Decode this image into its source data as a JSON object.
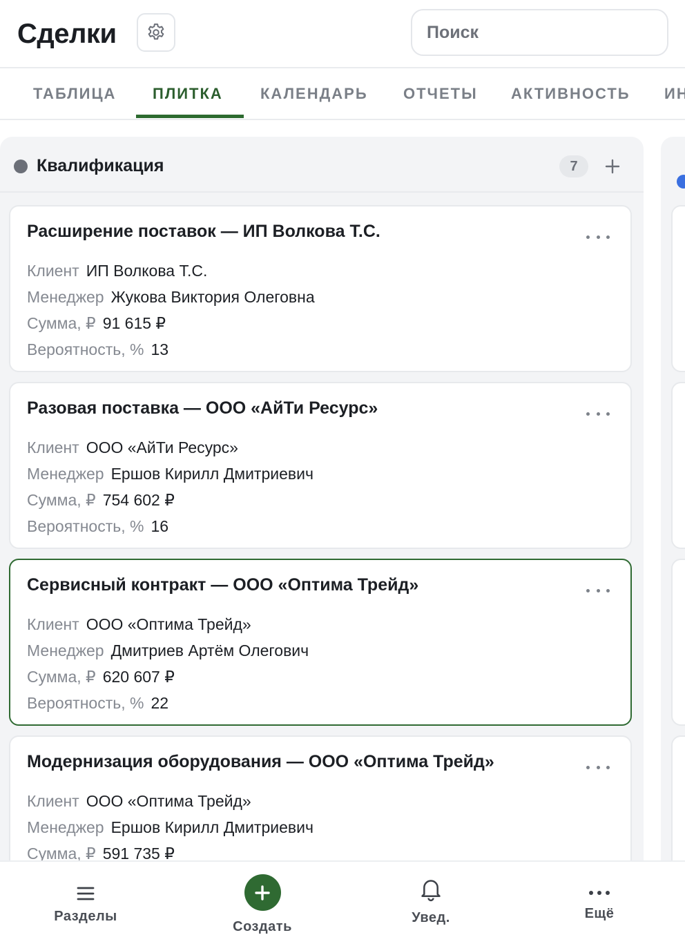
{
  "header": {
    "title": "Сделки",
    "settings_icon": "gear-icon",
    "search_placeholder": "Поиск"
  },
  "tabs": [
    {
      "label": "ТАБЛИЦА",
      "active": false
    },
    {
      "label": "ПЛИТКА",
      "active": true
    },
    {
      "label": "КАЛЕНДАРЬ",
      "active": false
    },
    {
      "label": "ОТЧЕТЫ",
      "active": false
    },
    {
      "label": "АКТИВНОСТЬ",
      "active": false
    },
    {
      "label": "ИН",
      "active": false
    }
  ],
  "column": {
    "title": "Квалификация",
    "count": "7",
    "dot_color": "#6b6f78"
  },
  "next_column": {
    "dot_color": "#3a6fe0"
  },
  "labels": {
    "client": "Клиент",
    "manager": "Менеджер",
    "amount": "Сумма, ₽",
    "probability": "Вероятность, %"
  },
  "cards": [
    {
      "title": "Расширение поставок — ИП Волкова Т.С.",
      "client": "ИП Волкова Т.С.",
      "manager": "Жукова Виктория Олеговна",
      "amount": "91 615 ₽",
      "probability": "13",
      "selected": false
    },
    {
      "title": "Разовая поставка — ООО «АйТи Ресурс»",
      "client": "ООО «АйТи Ресурс»",
      "manager": "Ершов Кирилл Дмитриевич",
      "amount": "754 602 ₽",
      "probability": "16",
      "selected": false
    },
    {
      "title": "Сервисный контракт — ООО «Оптима Трейд»",
      "client": "ООО «Оптима Трейд»",
      "manager": "Дмитриев Артём Олегович",
      "amount": "620 607 ₽",
      "probability": "22",
      "selected": true
    },
    {
      "title": "Модернизация оборудования — ООО «Оптима Трейд»",
      "client": "ООО «Оптима Трейд»",
      "manager": "Ершов Кирилл Дмитриевич",
      "amount": "591 735 ₽",
      "probability": "",
      "selected": false
    }
  ],
  "bottom_nav": [
    {
      "label": "Разделы",
      "icon": "menu-icon"
    },
    {
      "label": "Создать",
      "icon": "plus-icon"
    },
    {
      "label": "Увед.",
      "icon": "bell-icon"
    },
    {
      "label": "Ещё",
      "icon": "more-icon"
    }
  ],
  "colors": {
    "accent": "#2f6a32",
    "active_tab_text": "#2c5e2e"
  }
}
